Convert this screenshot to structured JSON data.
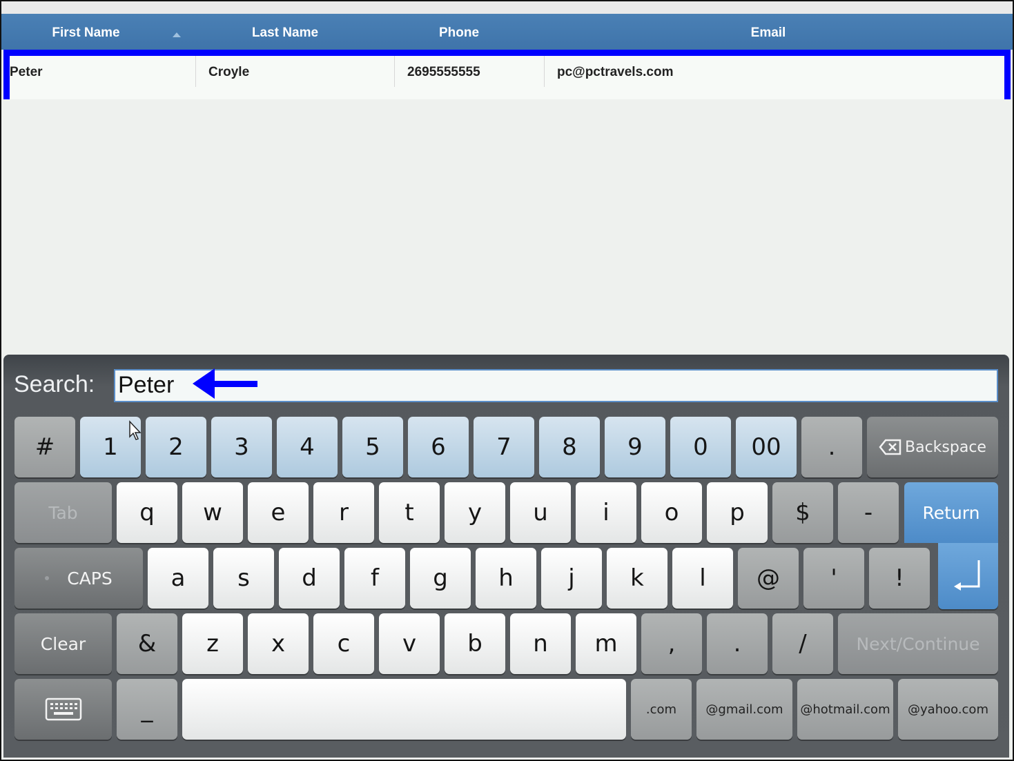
{
  "table": {
    "columns": [
      {
        "label": "First Name"
      },
      {
        "label": "Last Name"
      },
      {
        "label": "Phone"
      },
      {
        "label": "Email"
      }
    ],
    "rows": [
      {
        "first_name": "Peter",
        "last_name": "Croyle",
        "phone": "2695555555",
        "email": "pc@pctravels.com"
      }
    ]
  },
  "search": {
    "label": "Search:",
    "value": "Peter"
  },
  "keyboard": {
    "row1": [
      "#",
      "1",
      "2",
      "3",
      "4",
      "5",
      "6",
      "7",
      "8",
      "9",
      "0",
      "00",
      ".",
      "Backspace"
    ],
    "row2": [
      "Tab",
      "q",
      "w",
      "e",
      "r",
      "t",
      "y",
      "u",
      "i",
      "o",
      "p",
      "$",
      "-",
      "Return"
    ],
    "row3": [
      "CAPS",
      "a",
      "s",
      "d",
      "f",
      "g",
      "h",
      "j",
      "k",
      "l",
      "@",
      "'",
      "!"
    ],
    "row4": [
      "Clear",
      "&",
      "z",
      "x",
      "c",
      "v",
      "b",
      "n",
      "m",
      ",",
      ".",
      "/",
      "Next/Continue"
    ],
    "row5": [
      "_",
      ".com",
      "@gmail.com",
      "@hotmail.com",
      "@yahoo.com"
    ]
  },
  "colors": {
    "header": "#4a80b5",
    "highlight_border": "#0000ff",
    "arrow": "#0000ff",
    "return_key": "#5b97d1"
  }
}
